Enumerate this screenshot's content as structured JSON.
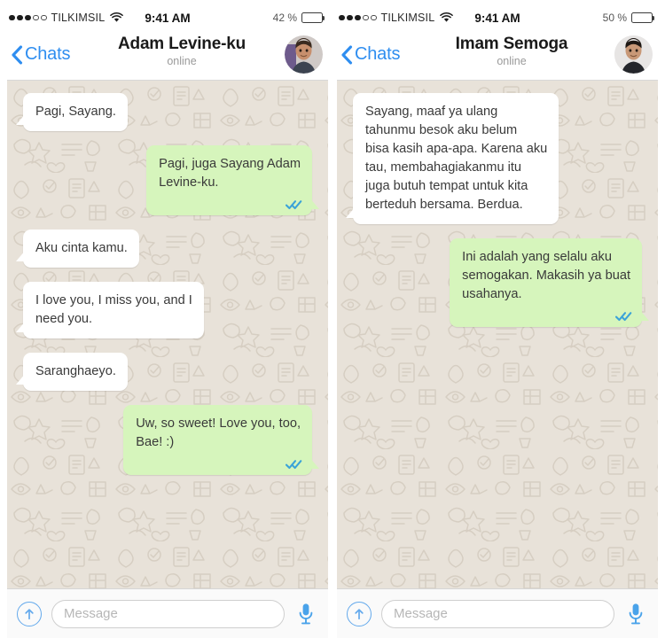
{
  "panels": [
    {
      "id": "left",
      "status_bar": {
        "carrier": "TILKIMSIL",
        "signal_filled": 3,
        "signal_total": 5,
        "wifi_icon": "wifi-icon",
        "time": "9:41 AM",
        "battery_percent": "42 %",
        "battery_level": 42
      },
      "header": {
        "back_label": "Chats",
        "back_icon": "chevron-left-icon",
        "contact_name": "Adam Levine-ku",
        "contact_status": "online",
        "avatar": "contact-avatar"
      },
      "messages": [
        {
          "direction": "in",
          "text": "Pagi, Sayang.",
          "ticks": false
        },
        {
          "direction": "out",
          "text": "Pagi, juga Sayang Adam\nLevine-ku.",
          "ticks": true
        },
        {
          "direction": "in",
          "text": "Aku cinta kamu.",
          "ticks": false
        },
        {
          "direction": "in",
          "text": "I love you, I miss you, and I\nneed you.",
          "ticks": false
        },
        {
          "direction": "in",
          "text": "Saranghaeyo.",
          "ticks": false
        },
        {
          "direction": "out",
          "text": "Uw, so sweet! Love you, too,\nBae! :)",
          "ticks": true
        }
      ],
      "input_bar": {
        "attach_icon": "attach-up-arrow-icon",
        "placeholder": "Message",
        "value": "",
        "mic_icon": "microphone-icon"
      }
    },
    {
      "id": "right",
      "status_bar": {
        "carrier": "TILKIMSIL",
        "signal_filled": 3,
        "signal_total": 5,
        "wifi_icon": "wifi-icon",
        "time": "9:41 AM",
        "battery_percent": "50 %",
        "battery_level": 50
      },
      "header": {
        "back_label": "Chats",
        "back_icon": "chevron-left-icon",
        "contact_name": "Imam Semoga",
        "contact_status": "online",
        "avatar": "contact-avatar"
      },
      "messages": [
        {
          "direction": "in",
          "text": "Sayang, maaf ya ulang\ntahunmu besok aku belum\nbisa kasih apa-apa. Karena aku\ntau, membahagiakanmu itu\njuga butuh tempat untuk kita\nberteduh bersama. Berdua.",
          "ticks": false
        },
        {
          "direction": "out",
          "text": "Ini adalah yang selalu aku\nsemogakan. Makasih ya buat\nusahanya.",
          "ticks": true
        }
      ],
      "input_bar": {
        "attach_icon": "attach-up-arrow-icon",
        "placeholder": "Message",
        "value": "",
        "mic_icon": "microphone-icon"
      }
    }
  ],
  "colors": {
    "accent_blue": "#2f8ef0",
    "outgoing_bubble": "#d6f5bc",
    "incoming_bubble": "#ffffff",
    "chat_background": "#e6e0d7",
    "tick_blue": "#3ba3d8",
    "status_text": "#9a9a9a"
  }
}
